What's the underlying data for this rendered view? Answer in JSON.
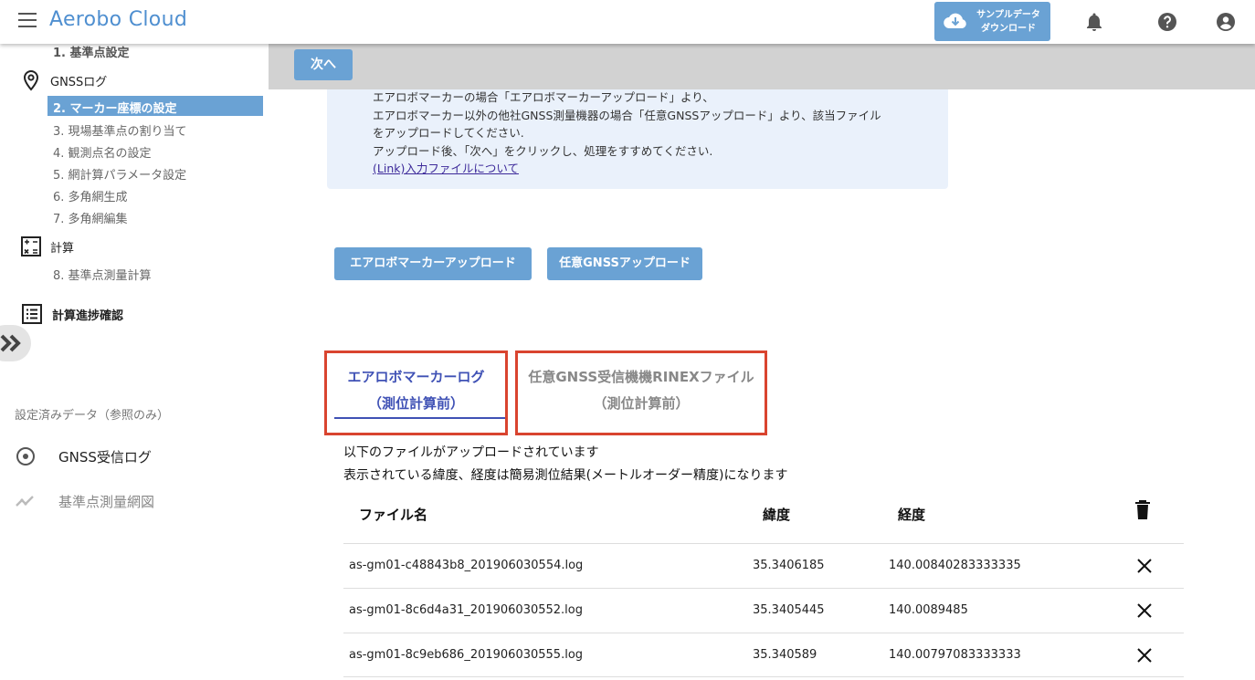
{
  "header": {
    "title": "Aerobo Cloud",
    "sample_line1": "サンプルデータ",
    "sample_line2": "ダウンロード"
  },
  "sidebar": {
    "step1": "1. 基準点設定",
    "gnss_section": "GNSSログ",
    "step2": "2. マーカー座標の設定",
    "step3": "3. 現場基準点の割り当て",
    "step4": "4. 観測点名の設定",
    "step5": "5. 網計算パラメータ設定",
    "step6": "6. 多角網生成",
    "step7": "7. 多角網編集",
    "calc_section": "計算",
    "step8": "8. 基準点測量計算",
    "progress_section": "計算進捗確認",
    "ref_label": "設定済みデータ（参照のみ）",
    "ref_gnss": "GNSS受信ログ",
    "ref_network": "基準点測量網図"
  },
  "toolbar": {
    "next_label": "次へ"
  },
  "info": {
    "line1": "エアロボマーカーの場合「エアロボマーカーアップロード」より、",
    "line2": "エアロボマーカー以外の他社GNSS測量機器の場合「任意GNSSアップロード」より、該当ファイル",
    "line3": "をアップロードしてください.",
    "line4": "アップロード後、「次へ」をクリックし、処理をすすめてください.",
    "link": "(Link)入力ファイルについて"
  },
  "upload": {
    "aerobo_label": "エアロボマーカーアップロード",
    "gnss_label": "任意GNSSアップロード"
  },
  "tabs": [
    {
      "line1": "エアロボマーカーログ",
      "line2": "（測位計算前）"
    },
    {
      "line1": "任意GNSS受信機機RINEXファイル",
      "line2": "（測位計算前）"
    }
  ],
  "notes": {
    "line1": "以下のファイルがアップロードされています",
    "line2": "表示されている緯度、経度は簡易測位結果(メートルオーダー精度)になります"
  },
  "table": {
    "headers": {
      "filename": "ファイル名",
      "lat": "緯度",
      "lon": "経度"
    },
    "rows": [
      {
        "filename": "as-gm01-c48843b8_201906030554.log",
        "lat": "35.3406185",
        "lon": "140.00840283333335"
      },
      {
        "filename": "as-gm01-8c6d4a31_201906030552.log",
        "lat": "35.3405445",
        "lon": "140.0089485"
      },
      {
        "filename": "as-gm01-8c9eb686_201906030555.log",
        "lat": "35.340589",
        "lon": "140.00797083333333"
      }
    ]
  },
  "colors": {
    "accent": "#6aa2d4",
    "title": "#4f8fd0",
    "tab_active": "#3f51b5",
    "highlight_border": "#d9442f",
    "info_bg": "#eaf1fb"
  }
}
